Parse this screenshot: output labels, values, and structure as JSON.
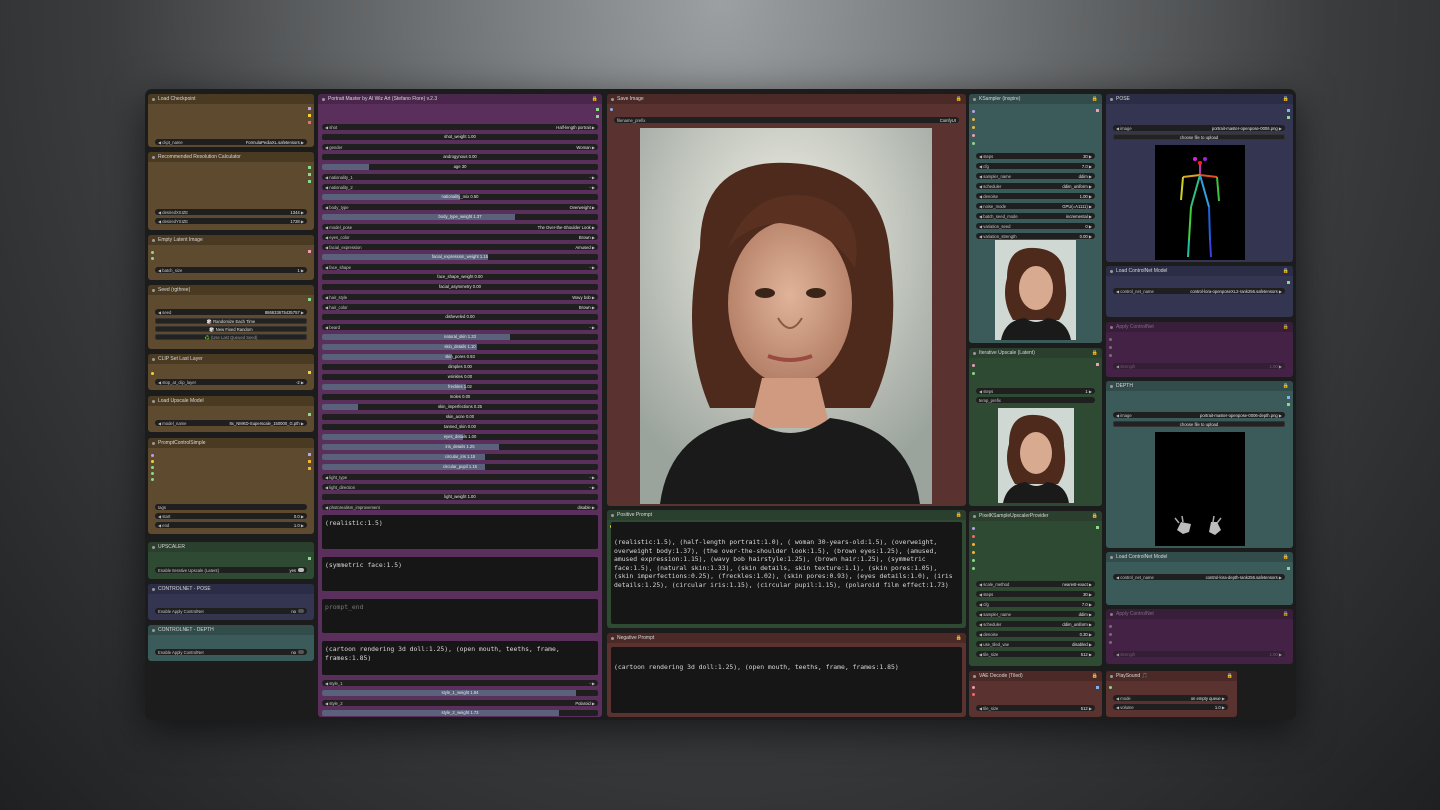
{
  "nodes": {
    "load_checkpoint": {
      "title": "Load Checkpoint",
      "ckpt_label": "ckpt_name",
      "ckpt_value": "FormulaPediaXL.safetensors"
    },
    "res_calc": {
      "title": "Recommended Resolution Calculator",
      "w_label": "desiredXSIZE",
      "w_value": "1344",
      "h_label": "desiredYSIZE",
      "h_value": "1728"
    },
    "empty_latent": {
      "title": "Empty Latent Image",
      "batch_label": "batch_size",
      "batch_value": "1"
    },
    "seed": {
      "title": "Seed (rgthree)",
      "seed_label": "seed",
      "seed_value": "886633675435757",
      "btn_randomize": "🎲 Randomize Each Time",
      "btn_fixed": "🎲 New Fixed Random",
      "btn_last": "♻️ (Use Last Queued Seed)"
    },
    "clip": {
      "title": "CLIP Set Last Layer",
      "label": "stop_at_clip_layer",
      "value": "-2"
    },
    "upscale_model": {
      "title": "Load Upscale Model",
      "label": "model_name",
      "value": "8x_NMKD-Superscale_150000_G.pth"
    },
    "prompt_control": {
      "title": "PromptControlSimple",
      "tags_label": "tags",
      "start_label": "start",
      "start_value": "0.0",
      "end_label": "end",
      "end_value": "1.0"
    },
    "upscaler_group": {
      "title": "UPSCALER",
      "label": "Enable Iterative Upscale (Latent)",
      "value": "yes"
    },
    "cn_pose_group": {
      "title": "CONTROLNET - POSE",
      "label": "Enable Apply ControlNet",
      "value": "no"
    },
    "cn_depth_group": {
      "title": "CONTROLNET - DEPTH",
      "label": "Enable Apply ControlNet",
      "value": "no"
    },
    "portrait_master": {
      "title": "Portrait Master by AI Wiz Art (Stefano Flore) v.2.3",
      "rows": [
        {
          "type": "combo",
          "label": "shot",
          "value": "Half-length portrait"
        },
        {
          "type": "slider",
          "label": "shot_weight",
          "value": "1.00",
          "fill": 0
        },
        {
          "type": "combo",
          "label": "gender",
          "value": "Woman"
        },
        {
          "type": "slider",
          "label": "androgynous",
          "value": "0.00",
          "fill": 0
        },
        {
          "type": "slider",
          "label": "age",
          "value": "30",
          "fill": 0.17
        },
        {
          "type": "combo",
          "label": "nationality_1",
          "value": "-"
        },
        {
          "type": "combo",
          "label": "nationality_2",
          "value": "-"
        },
        {
          "type": "slider",
          "label": "nationality_mix",
          "value": "0.50",
          "fill": 0.5
        },
        {
          "type": "combo",
          "label": "body_type",
          "value": "Overweight"
        },
        {
          "type": "slider",
          "label": "body_type_weight",
          "value": "1.37",
          "fill": 0.7
        },
        {
          "type": "combo",
          "label": "model_pose",
          "value": "The Over-the-Shoulder Look"
        },
        {
          "type": "combo",
          "label": "eyes_color",
          "value": "Brown"
        },
        {
          "type": "combo",
          "label": "facial_expression",
          "value": "Amused"
        },
        {
          "type": "slider",
          "label": "facial_expression_weight",
          "value": "1.15",
          "fill": 0.6
        },
        {
          "type": "combo",
          "label": "face_shape",
          "value": "-"
        },
        {
          "type": "slider",
          "label": "face_shape_weight",
          "value": "0.00",
          "fill": 0
        },
        {
          "type": "slider",
          "label": "facial_asymmetry",
          "value": "0.00",
          "fill": 0
        },
        {
          "type": "combo",
          "label": "hair_style",
          "value": "Wavy bob"
        },
        {
          "type": "combo",
          "label": "hair_color",
          "value": "Brown"
        },
        {
          "type": "slider",
          "label": "disheveled",
          "value": "0.00",
          "fill": 0
        },
        {
          "type": "combo",
          "label": "beard",
          "value": "-"
        },
        {
          "type": "slider",
          "label": "natural_skin",
          "value": "1.33",
          "fill": 0.68
        },
        {
          "type": "slider",
          "label": "skin_details",
          "value": "1.10",
          "fill": 0.56
        },
        {
          "type": "slider",
          "label": "skin_pores",
          "value": "0.93",
          "fill": 0.47
        },
        {
          "type": "slider",
          "label": "dimples",
          "value": "0.00",
          "fill": 0
        },
        {
          "type": "slider",
          "label": "wrinkles",
          "value": "0.00",
          "fill": 0
        },
        {
          "type": "slider",
          "label": "freckles",
          "value": "1.02",
          "fill": 0.52
        },
        {
          "type": "slider",
          "label": "moles",
          "value": "0.00",
          "fill": 0
        },
        {
          "type": "slider",
          "label": "skin_imperfections",
          "value": "0.25",
          "fill": 0.13
        },
        {
          "type": "slider",
          "label": "skin_acne",
          "value": "0.00",
          "fill": 0
        },
        {
          "type": "slider",
          "label": "tanned_skin",
          "value": "0.00",
          "fill": 0
        },
        {
          "type": "slider",
          "label": "eyes_details",
          "value": "1.00",
          "fill": 0.51
        },
        {
          "type": "slider",
          "label": "iris_details",
          "value": "1.25",
          "fill": 0.64
        },
        {
          "type": "slider",
          "label": "circular_iris",
          "value": "1.15",
          "fill": 0.59
        },
        {
          "type": "slider",
          "label": "circular_pupil",
          "value": "1.15",
          "fill": 0.59
        },
        {
          "type": "combo",
          "label": "light_type",
          "value": "-"
        },
        {
          "type": "combo",
          "label": "light_direction",
          "value": "-"
        },
        {
          "type": "slider",
          "label": "light_weight",
          "value": "1.00",
          "fill": 0
        },
        {
          "type": "combo",
          "label": "photorealism_improvement",
          "value": "disable"
        }
      ],
      "prompt_start": "(realistic:1.5)",
      "prompt_additional": "(symmetric face:1.5)",
      "prompt_end_placeholder": "prompt_end",
      "negative": "(cartoon rendering 3d doll:1.25), (open mouth, teeths, frame, frames:1.85)",
      "style_rows": [
        {
          "type": "combo",
          "label": "style_1",
          "value": "-"
        },
        {
          "type": "slider",
          "label": "style_1_weight",
          "value": "1.84",
          "fill": 0.92
        },
        {
          "type": "combo",
          "label": "style_2",
          "value": "Polaroid"
        },
        {
          "type": "slider",
          "label": "style_2_weight",
          "value": "1.73",
          "fill": 0.86
        }
      ]
    },
    "save_image": {
      "title": "Save Image",
      "prefix_label": "filename_prefix",
      "prefix_value": "ComfyUI"
    },
    "positive_prompt": {
      "title": "Positive Prompt",
      "text": "(realistic:1.5), (half-length portrait:1.0), ( woman 30-years-old:1.5), (overweight, overweight body:1.37), (the over-the-shoulder look:1.5), (brown eyes:1.25), (amused, amused expression:1.15), (wavy bob hairstyle:1.25), (brown hair:1.25), (symmetric face:1.5), (natural skin:1.33), (skin details, skin texture:1.1), (skin pores:1.05), (skin imperfections:0.25), (freckles:1.02), (skin pores:0.93), (eyes details:1.0), (iris details:1.25), (circular iris:1.15), (circular pupil:1.15), (polaroid film effect:1.73)"
    },
    "negative_prompt": {
      "title": "Negative Prompt",
      "text": "(cartoon rendering 3d doll:1.25), (open mouth, teeths, frame, frames:1.85)"
    },
    "ksampler": {
      "title": "KSampler (inspire)",
      "rows": [
        {
          "label": "steps",
          "value": "30"
        },
        {
          "label": "cfg",
          "value": "7.0"
        },
        {
          "label": "sampler_name",
          "value": "ddim"
        },
        {
          "label": "scheduler",
          "value": "ddim_uniform"
        },
        {
          "label": "denoise",
          "value": "1.00"
        },
        {
          "label": "noise_mode",
          "value": "GPU(=A1111)"
        },
        {
          "label": "batch_seed_mode",
          "value": "incremental"
        },
        {
          "label": "variation_seed",
          "value": "0"
        },
        {
          "label": "variation_strength",
          "value": "0.00"
        }
      ]
    },
    "iter_upscale": {
      "title": "Iterative Upscale (Latent)",
      "steps_label": "steps",
      "steps_value": "1",
      "prefix_label": "temp_prefix"
    },
    "pixel_ksampler": {
      "title": "PixelKSampleUpscalerProvider",
      "rows": [
        {
          "label": "scale_method",
          "value": "nearest-exact"
        },
        {
          "label": "steps",
          "value": "30"
        },
        {
          "label": "cfg",
          "value": "7.0"
        },
        {
          "label": "sampler_name",
          "value": "ddim"
        },
        {
          "label": "scheduler",
          "value": "ddim_uniform"
        },
        {
          "label": "denoise",
          "value": "0.30"
        },
        {
          "label": "use_tiled_vae",
          "value": "disabled"
        },
        {
          "label": "tile_size",
          "value": "512"
        }
      ]
    },
    "vae_decode": {
      "title": "VAE Decode (Tiled)",
      "label": "tile_size",
      "value": "512"
    },
    "pose": {
      "title": "POSE",
      "image_label": "image",
      "image_value": "portrait-master-openpose-0006.png",
      "upload": "choose file to upload"
    },
    "cn_load_pose": {
      "title": "Load ControlNet Model",
      "label": "control_net_name",
      "value": "control-lora-openposeXL2-rank256.safetensors"
    },
    "apply_cn_1": {
      "title": "Apply ControlNet",
      "label": "strength",
      "value": "1.00"
    },
    "depth": {
      "title": "DEPTH",
      "image_label": "image",
      "image_value": "portrait-master-openpose-0006-depth.png",
      "upload": "choose file to upload"
    },
    "cn_load_depth": {
      "title": "Load ControlNet Model",
      "label": "control_net_name",
      "value": "control-lora-depth-rank256.safetensors"
    },
    "apply_cn_2": {
      "title": "Apply ControlNet",
      "label": "strength",
      "value": "1.00"
    },
    "play_sound": {
      "title": "PlaySound 🎵",
      "mode_label": "mode",
      "mode_value": "on empty queue",
      "volume_label": "volume",
      "volume_value": "1.0"
    }
  },
  "colors": {
    "brown": "#5e4a2f",
    "purple": "#5a2f5c",
    "teal": "#3b5a5a",
    "green": "#2f4a33",
    "navy": "#333551",
    "redbrown": "#5a3230",
    "violet": "#4d2450",
    "accent_lock": "#f2b532"
  }
}
